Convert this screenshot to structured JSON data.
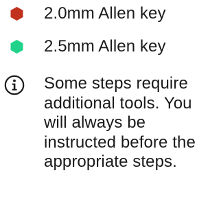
{
  "tools": [
    {
      "label": "2.0mm Allen key",
      "icon": "hex-red-icon",
      "color": "#c0321e"
    },
    {
      "label": "2.5mm Allen key",
      "icon": "hex-green-icon",
      "color": "#21d38a"
    }
  ],
  "note": {
    "icon": "info-icon",
    "text": "Some steps require additional tools. You will always be instructed before the appropriate steps."
  }
}
